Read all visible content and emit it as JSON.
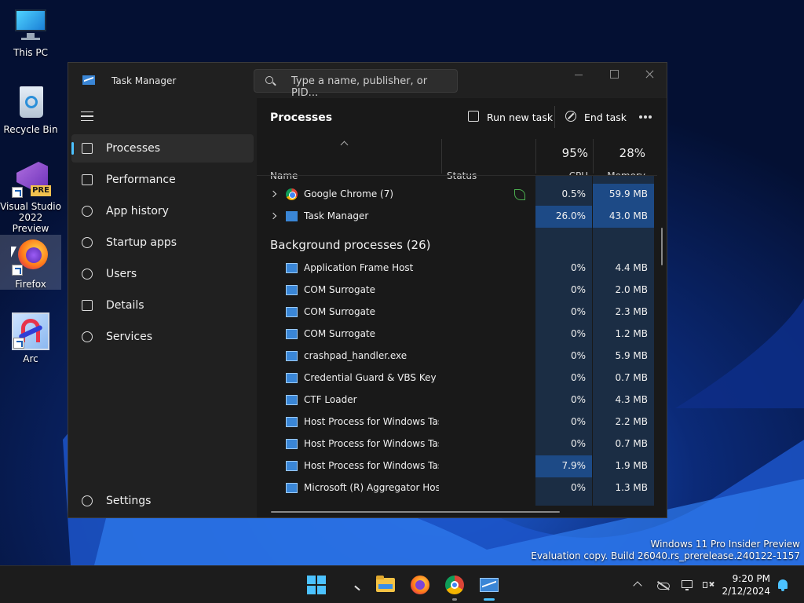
{
  "desktop": {
    "icons": [
      {
        "label": "This PC"
      },
      {
        "label": "Recycle Bin"
      },
      {
        "label": "Visual Studio 2022 Preview",
        "badge": "PRE"
      },
      {
        "label": "Firefox"
      },
      {
        "label": "Arc"
      }
    ]
  },
  "window": {
    "title": "Task Manager",
    "search_placeholder": "Type a name, publisher, or PID..."
  },
  "sidebar": {
    "items": [
      {
        "label": "Processes",
        "icon": "processes-icon"
      },
      {
        "label": "Performance",
        "icon": "performance-icon"
      },
      {
        "label": "App history",
        "icon": "history-icon"
      },
      {
        "label": "Startup apps",
        "icon": "startup-icon"
      },
      {
        "label": "Users",
        "icon": "users-icon"
      },
      {
        "label": "Details",
        "icon": "details-icon"
      },
      {
        "label": "Services",
        "icon": "services-icon"
      }
    ],
    "settings_label": "Settings"
  },
  "main": {
    "title": "Processes",
    "run_new_task": "Run new task",
    "end_task": "End task",
    "columns": {
      "name": "Name",
      "status": "Status",
      "cpu_pct": "95%",
      "cpu": "CPU",
      "mem_pct": "28%",
      "memory": "Memory"
    },
    "apps": [
      {
        "name": "Google Chrome (7)",
        "cpu": "0.5%",
        "mem": "59.9 MB",
        "icon": "chrome"
      },
      {
        "name": "Task Manager",
        "cpu": "26.0%",
        "mem": "43.0 MB",
        "icon": "tm"
      }
    ],
    "background_header": "Background processes (26)",
    "background": [
      {
        "name": "Application Frame Host",
        "cpu": "0%",
        "mem": "4.4 MB"
      },
      {
        "name": "COM Surrogate",
        "cpu": "0%",
        "mem": "2.0 MB"
      },
      {
        "name": "COM Surrogate",
        "cpu": "0%",
        "mem": "2.3 MB"
      },
      {
        "name": "COM Surrogate",
        "cpu": "0%",
        "mem": "1.2 MB"
      },
      {
        "name": "crashpad_handler.exe",
        "cpu": "0%",
        "mem": "5.9 MB"
      },
      {
        "name": "Credential Guard & VBS Key Is...",
        "cpu": "0%",
        "mem": "0.7 MB"
      },
      {
        "name": "CTF Loader",
        "cpu": "0%",
        "mem": "4.3 MB"
      },
      {
        "name": "Host Process for Windows Tasks",
        "cpu": "0%",
        "mem": "2.2 MB"
      },
      {
        "name": "Host Process for Windows Tasks",
        "cpu": "0%",
        "mem": "0.7 MB"
      },
      {
        "name": "Host Process for Windows Tasks",
        "cpu": "7.9%",
        "mem": "1.9 MB"
      },
      {
        "name": "Microsoft (R) Aggregator Host",
        "cpu": "0%",
        "mem": "1.3 MB"
      }
    ]
  },
  "watermark": {
    "line1": "Windows 11 Pro Insider Preview",
    "line2": "Evaluation copy. Build 26040.rs_prerelease.240122-1157"
  },
  "taskbar": {
    "time": "9:20 PM",
    "date": "2/12/2024"
  },
  "colors": {
    "accent": "#4cc2ff",
    "heat_low": "#1b2d44",
    "heat_high": "#1d4a86"
  }
}
